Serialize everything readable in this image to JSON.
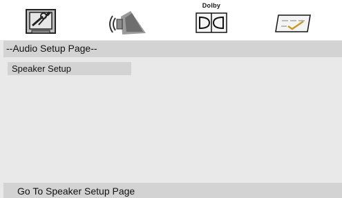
{
  "tabs": {
    "general": {
      "icon": "general-setup-icon"
    },
    "audio": {
      "icon": "speaker-icon"
    },
    "dolby": {
      "icon": "dolby-icon",
      "label": "Dolby"
    },
    "preference": {
      "icon": "preference-icon"
    }
  },
  "page": {
    "title": "--Audio Setup Page--"
  },
  "menu": {
    "items": [
      {
        "label": "Speaker Setup",
        "selected": true
      }
    ]
  },
  "status": {
    "text": "Go To Speaker Setup Page"
  },
  "colors": {
    "background": "#e9e9e9",
    "tab_bar": "#ffffff",
    "highlight_bar": "#d3d3d3",
    "text": "#111111"
  }
}
